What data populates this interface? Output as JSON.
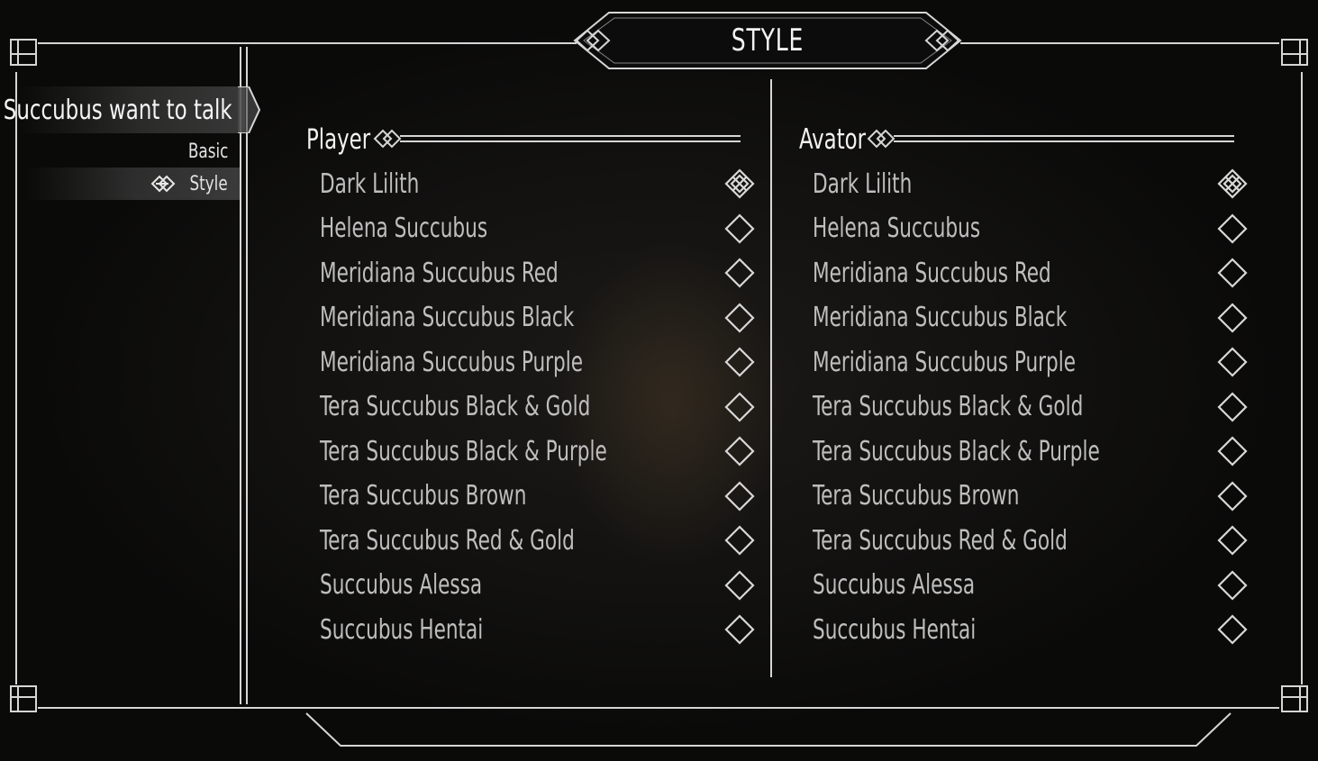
{
  "title": "STYLE",
  "mod_list": [
    {
      "label": "Succubus want to talk",
      "selected": true
    }
  ],
  "pages": [
    {
      "label": "Basic",
      "selected": false
    },
    {
      "label": "Style",
      "selected": true,
      "icon": "knot-selector-icon"
    }
  ],
  "columns": [
    {
      "header": "Player",
      "options": [
        {
          "label": "Dark Lilith",
          "checked": true
        },
        {
          "label": "Helena Succubus",
          "checked": false
        },
        {
          "label": "Meridiana Succubus Red",
          "checked": false
        },
        {
          "label": "Meridiana Succubus Black",
          "checked": false
        },
        {
          "label": "Meridiana Succubus Purple",
          "checked": false
        },
        {
          "label": "Tera Succubus Black & Gold",
          "checked": false
        },
        {
          "label": "Tera Succubus Black & Purple",
          "checked": false
        },
        {
          "label": "Tera Succubus Brown",
          "checked": false
        },
        {
          "label": "Tera Succubus Red & Gold",
          "checked": false
        },
        {
          "label": "Succubus Alessa",
          "checked": false
        },
        {
          "label": "Succubus Hentai",
          "checked": false
        }
      ]
    },
    {
      "header": "Avator",
      "options": [
        {
          "label": "Dark Lilith",
          "checked": true
        },
        {
          "label": "Helena Succubus",
          "checked": false
        },
        {
          "label": "Meridiana Succubus Red",
          "checked": false
        },
        {
          "label": "Meridiana Succubus Black",
          "checked": false
        },
        {
          "label": "Meridiana Succubus Purple",
          "checked": false
        },
        {
          "label": "Tera Succubus Black & Gold",
          "checked": false
        },
        {
          "label": "Tera Succubus Black & Purple",
          "checked": false
        },
        {
          "label": "Tera Succubus Brown",
          "checked": false
        },
        {
          "label": "Tera Succubus Red & Gold",
          "checked": false
        },
        {
          "label": "Succubus Alessa",
          "checked": false
        },
        {
          "label": "Succubus Hentai",
          "checked": false
        }
      ]
    }
  ],
  "icons": {
    "checked": "knot-checkbox-checked-icon",
    "unchecked": "diamond-checkbox-empty-icon",
    "header_ornament": "header-knot-ornament-icon"
  },
  "colors": {
    "frame": "#d6d6d6",
    "text_primary": "#f2f2f2",
    "text_option": "#bebebe",
    "background": "#0d0c0b"
  }
}
